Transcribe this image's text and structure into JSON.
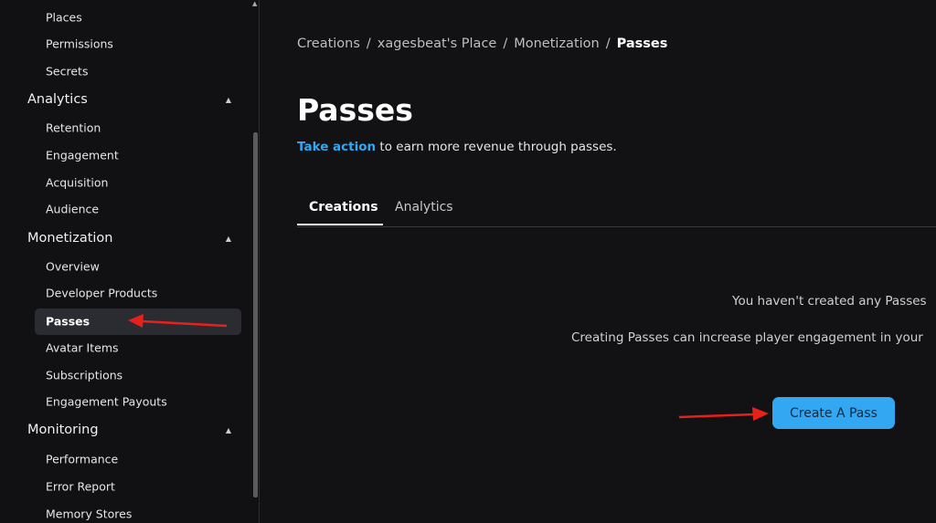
{
  "sidebar": {
    "items_top": [
      "Places",
      "Permissions",
      "Secrets"
    ],
    "analytics": {
      "label": "Analytics",
      "items": [
        "Retention",
        "Engagement",
        "Acquisition",
        "Audience"
      ]
    },
    "monetization": {
      "label": "Monetization",
      "items": [
        "Overview",
        "Developer Products",
        "Passes",
        "Avatar Items",
        "Subscriptions",
        "Engagement Payouts"
      ]
    },
    "monitoring": {
      "label": "Monitoring",
      "items": [
        "Performance",
        "Error Report",
        "Memory Stores"
      ]
    },
    "caret": "▲",
    "active_item": "Passes"
  },
  "breadcrumb": [
    "Creations",
    "xagesbeat's Place",
    "Monetization",
    "Passes"
  ],
  "breadcrumb_sep": "/",
  "page": {
    "title": "Passes",
    "subtitle_link": "Take action",
    "subtitle_rest": " to earn more revenue through passes."
  },
  "tabs": [
    "Creations",
    "Analytics"
  ],
  "empty": {
    "line1": "You haven't created any Passes",
    "line2": "Creating Passes can increase player engagement in your",
    "button": "Create A Pass"
  },
  "colors": {
    "accent": "#33a7f2",
    "annotation_arrow": "#e8201c"
  }
}
